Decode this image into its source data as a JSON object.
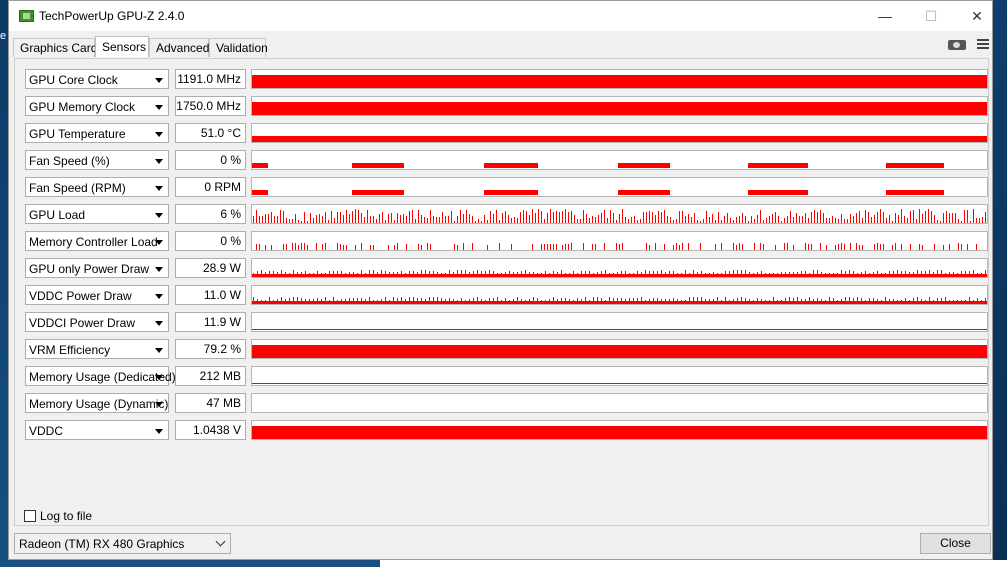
{
  "window": {
    "title": "TechPowerUp GPU-Z 2.4.0",
    "controls": {
      "minimize": "—",
      "maximize": "☐",
      "close": "✕"
    }
  },
  "tabs": [
    {
      "label": "Graphics Card",
      "active": false
    },
    {
      "label": "Sensors",
      "active": true
    },
    {
      "label": "Advanced",
      "active": false
    },
    {
      "label": "Validation",
      "active": false
    }
  ],
  "toolbar": {
    "camera_icon": "camera-icon",
    "menu_icon": "hamburger-menu-icon"
  },
  "graph_color": "#ff0000",
  "sensors": [
    {
      "name": "GPU Core Clock",
      "value": "1191.0 MHz",
      "pattern": "full"
    },
    {
      "name": "GPU Memory Clock",
      "value": "1750.0 MHz",
      "pattern": "full"
    },
    {
      "name": "GPU Temperature",
      "value": "51.0 °C",
      "pattern": "mid"
    },
    {
      "name": "Fan Speed (%)",
      "value": "0 %",
      "pattern": "dashes"
    },
    {
      "name": "Fan Speed (RPM)",
      "value": "0 RPM",
      "pattern": "dashes"
    },
    {
      "name": "GPU Load",
      "value": "6 %",
      "pattern": "spikes"
    },
    {
      "name": "Memory Controller Load",
      "value": "0 %",
      "pattern": "sparse"
    },
    {
      "name": "GPU only Power Draw",
      "value": "28.9 W",
      "pattern": "noisy"
    },
    {
      "name": "VDDC Power Draw",
      "value": "11.0 W",
      "pattern": "noisy"
    },
    {
      "name": "VDDCI Power Draw",
      "value": "11.9 W",
      "pattern": "thin"
    },
    {
      "name": "VRM Efficiency",
      "value": "79.2 %",
      "pattern": "full"
    },
    {
      "name": "Memory Usage (Dedicated)",
      "value": "212 MB",
      "pattern": "low"
    },
    {
      "name": "Memory Usage (Dynamic)",
      "value": "47 MB",
      "pattern": "none"
    },
    {
      "name": "VDDC",
      "value": "1.0438 V",
      "pattern": "full"
    }
  ],
  "log_to_file": {
    "label": "Log to file",
    "checked": false
  },
  "gpu_select": {
    "value": "Radeon (TM) RX 480 Graphics"
  },
  "close_button": {
    "label": "Close"
  }
}
